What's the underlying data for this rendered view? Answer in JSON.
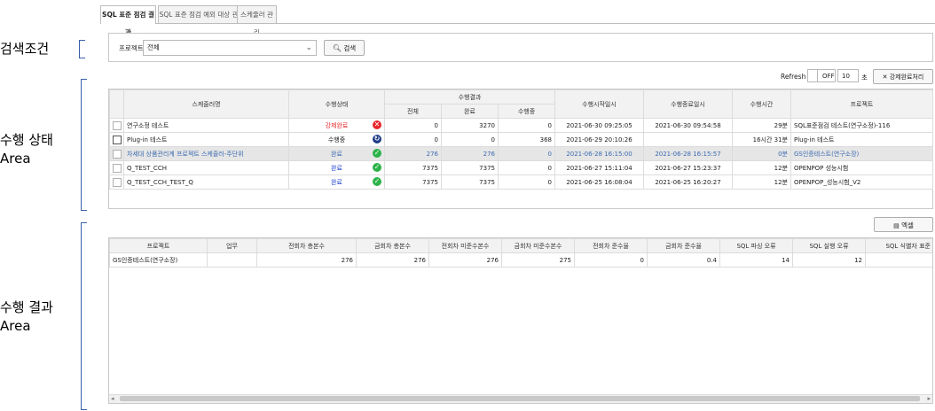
{
  "tabs": [
    "SQL 표준 점검 결과",
    "SQL 표준 점검 예외 대상 관리",
    "스케줄러 관리"
  ],
  "side_labels": {
    "search": "검색조건",
    "status": "수행 상태\nArea",
    "result": "수행 결과\nArea"
  },
  "search": {
    "project_label": "프로젝트",
    "project_value": "전체",
    "search_button": "검색"
  },
  "refresh": {
    "label": "Refresh",
    "toggle": "OFF",
    "interval": "10",
    "unit": "초",
    "force_complete_button": "강제완료처리"
  },
  "status_table": {
    "headers": {
      "scheduler": "스케줄러명",
      "state": "수행상태",
      "result_group": "수행결과",
      "total": "전체",
      "done": "완료",
      "running": "수행중",
      "start": "수행시작일시",
      "end": "수행종료일시",
      "elapsed": "수행시간",
      "project": "프로젝트"
    },
    "rows": [
      {
        "name": "연구소정 테스트",
        "state": "강제완료",
        "state_icon": "error-x-icon",
        "total": "0",
        "done": "3270",
        "running": "0",
        "start": "2021-06-30 09:25:05",
        "end": "2021-06-30 09:54:58",
        "elapsed": "29분",
        "project": "SQL표준점검 테스트(연구소정)-116"
      },
      {
        "name": "Plug-in 테스트",
        "state": "수행중",
        "state_icon": "running-icon",
        "total": "0",
        "done": "0",
        "running": "368",
        "start": "2021-06-29 20:10:26",
        "end": "",
        "elapsed": "16시간 31분",
        "project": "Plug-in 테스트"
      },
      {
        "name": "차세대 상품관리계 프로젝트 스케줄러-주단위",
        "state": "완료",
        "state_icon": "check-icon",
        "total": "276",
        "done": "276",
        "running": "0",
        "start": "2021-06-28 16:15:00",
        "end": "2021-06-28 16:15:57",
        "elapsed": "0분",
        "project": "GS인증테스트(연구소장)"
      },
      {
        "name": "Q_TEST_CCH",
        "state": "완료",
        "state_icon": "check-icon",
        "total": "7375",
        "done": "7375",
        "running": "0",
        "start": "2021-06-27 15:11:04",
        "end": "2021-06-27 15:23:37",
        "elapsed": "12분",
        "project": "OPENPOP 성능시험"
      },
      {
        "name": "Q_TEST_CCH_TEST_Q",
        "state": "완료",
        "state_icon": "check-icon",
        "total": "7375",
        "done": "7375",
        "running": "0",
        "start": "2021-06-25 16:08:04",
        "end": "2021-06-25 16:20:27",
        "elapsed": "12분",
        "project": "OPENPOP_성능시험_V2"
      }
    ]
  },
  "excel_button": "엑셀",
  "result_table": {
    "headers": [
      "프로젝트",
      "업무",
      "전회차 총본수",
      "금회차 총본수",
      "전회차 미준수본수",
      "금회차 미준수본수",
      "전회차 준수율",
      "금회차 준수율",
      "SQL 파싱 오류",
      "SQL 실행 오류",
      "SQL 식별자 표준 미준수"
    ],
    "rows": [
      [
        "GS인증테스트(연구소장)",
        "",
        "276",
        "276",
        "276",
        "275",
        "0",
        "0.4",
        "14",
        "12",
        ""
      ]
    ]
  },
  "colors": {
    "accent": "#1d3fcc",
    "error": "#e8262b",
    "success": "#2cb34a",
    "running": "#1f3c88"
  }
}
